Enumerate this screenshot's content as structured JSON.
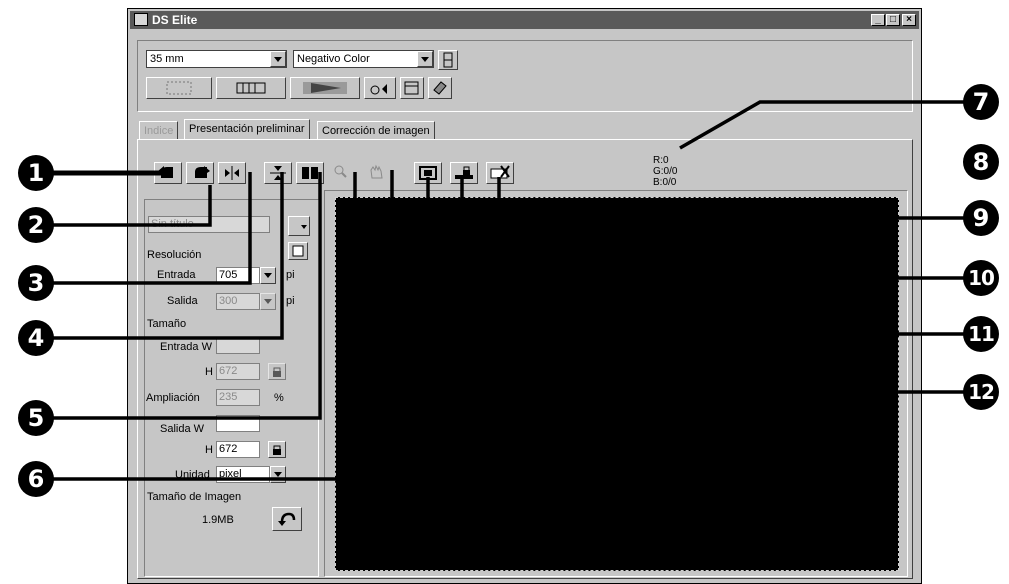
{
  "window": {
    "title": "DS Elite",
    "min": "_",
    "max": "□",
    "close": "×"
  },
  "toolbar": {
    "film_format": "35 mm",
    "film_type": "Negativo Color"
  },
  "tabs": [
    {
      "label": "Indice"
    },
    {
      "label": "Presentación preliminar"
    },
    {
      "label": "Corrección de imagen"
    }
  ],
  "readout": {
    "r": "R:0",
    "g": "G:0/0",
    "b": "B:0/0"
  },
  "panel": {
    "title_field": "Sin título",
    "resolution_label": "Resolución",
    "input_label": "Entrada",
    "input_value": "705",
    "input_unit": "pi",
    "output_label": "Salida",
    "output_value": "300",
    "output_unit": "pi",
    "size_label": "Tamaño",
    "input_w_label": "Entrada W",
    "input_h_label": "H",
    "input_h_value": "672",
    "zoom_label": "Ampliación",
    "zoom_value": "235",
    "zoom_unit": "%",
    "output_w_label": "Salida W",
    "output_h_label": "H",
    "output_h_value": "672",
    "unit_label": "Unidad",
    "unit_value": "pixel",
    "image_size_label": "Tamaño de Imagen",
    "image_size_value": "1.9MB"
  },
  "callouts": [
    "1",
    "2",
    "3",
    "4",
    "5",
    "6",
    "7",
    "8",
    "9",
    "10",
    "11",
    "12"
  ]
}
